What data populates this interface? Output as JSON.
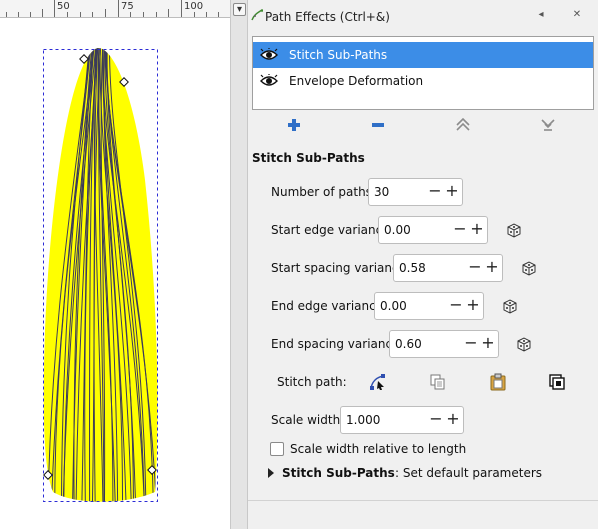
{
  "ruler": {
    "labels": [
      "50",
      "75",
      "100"
    ]
  },
  "dialog": {
    "title": "Path Effects (Ctrl+&)",
    "effects": [
      {
        "label": "Stitch Sub-Paths",
        "selected": true,
        "icon": "eye-icon"
      },
      {
        "label": "Envelope Deformation",
        "selected": false,
        "icon": "eye-icon"
      }
    ],
    "toolbar_icons": [
      "add-icon",
      "remove-icon",
      "move-up-icon",
      "move-down-icon"
    ],
    "section_title": "Stitch Sub-Paths",
    "params": {
      "num_paths": {
        "label": "Number of paths:",
        "value": "30"
      },
      "start_edge": {
        "label": "Start edge variance:",
        "value": "0.00"
      },
      "start_spacing": {
        "label": "Start spacing variance:",
        "value": "0.58"
      },
      "end_edge": {
        "label": "End edge variance:",
        "value": "0.00"
      },
      "end_spacing": {
        "label": "End spacing variance:",
        "value": "0.60"
      },
      "stitch_path": {
        "label": "Stitch path:"
      },
      "scale_width": {
        "label": "Scale width:",
        "value": "1.000"
      }
    },
    "scale_relative": {
      "label": "Scale width relative to length",
      "checked": false
    },
    "expander": {
      "name": "Stitch Sub-Paths",
      "text": ": Set default parameters"
    },
    "spin_minus": "−",
    "spin_plus": "+"
  },
  "colors": {
    "selection": "#3c8de7",
    "shape_fill": "#ffff00",
    "stitch_line": "#3a3a5a",
    "add_blue": "#2f6fc7"
  }
}
